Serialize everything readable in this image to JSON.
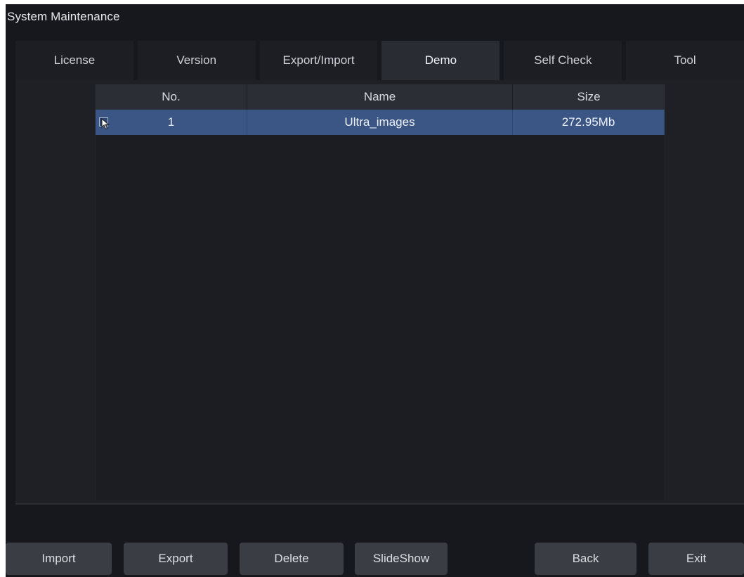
{
  "window": {
    "title": "System Maintenance"
  },
  "tabs": [
    {
      "label": "License"
    },
    {
      "label": "Version"
    },
    {
      "label": "Export/Import"
    },
    {
      "label": "Demo"
    },
    {
      "label": "Self Check"
    },
    {
      "label": "Tool"
    }
  ],
  "active_tab": "Demo",
  "table": {
    "columns": {
      "no": "No.",
      "name": "Name",
      "size": "Size"
    },
    "rows": [
      {
        "no": "1",
        "name": "Ultra_images",
        "size": "272.95Mb",
        "selected": true
      }
    ]
  },
  "buttons": {
    "import": "Import",
    "export": "Export",
    "delete": "Delete",
    "slideshow": "SlideShow",
    "back": "Back",
    "exit": "Exit"
  },
  "colors": {
    "background": "#16181d",
    "selected_row": "#3b5585",
    "button": "#3a3d44"
  }
}
